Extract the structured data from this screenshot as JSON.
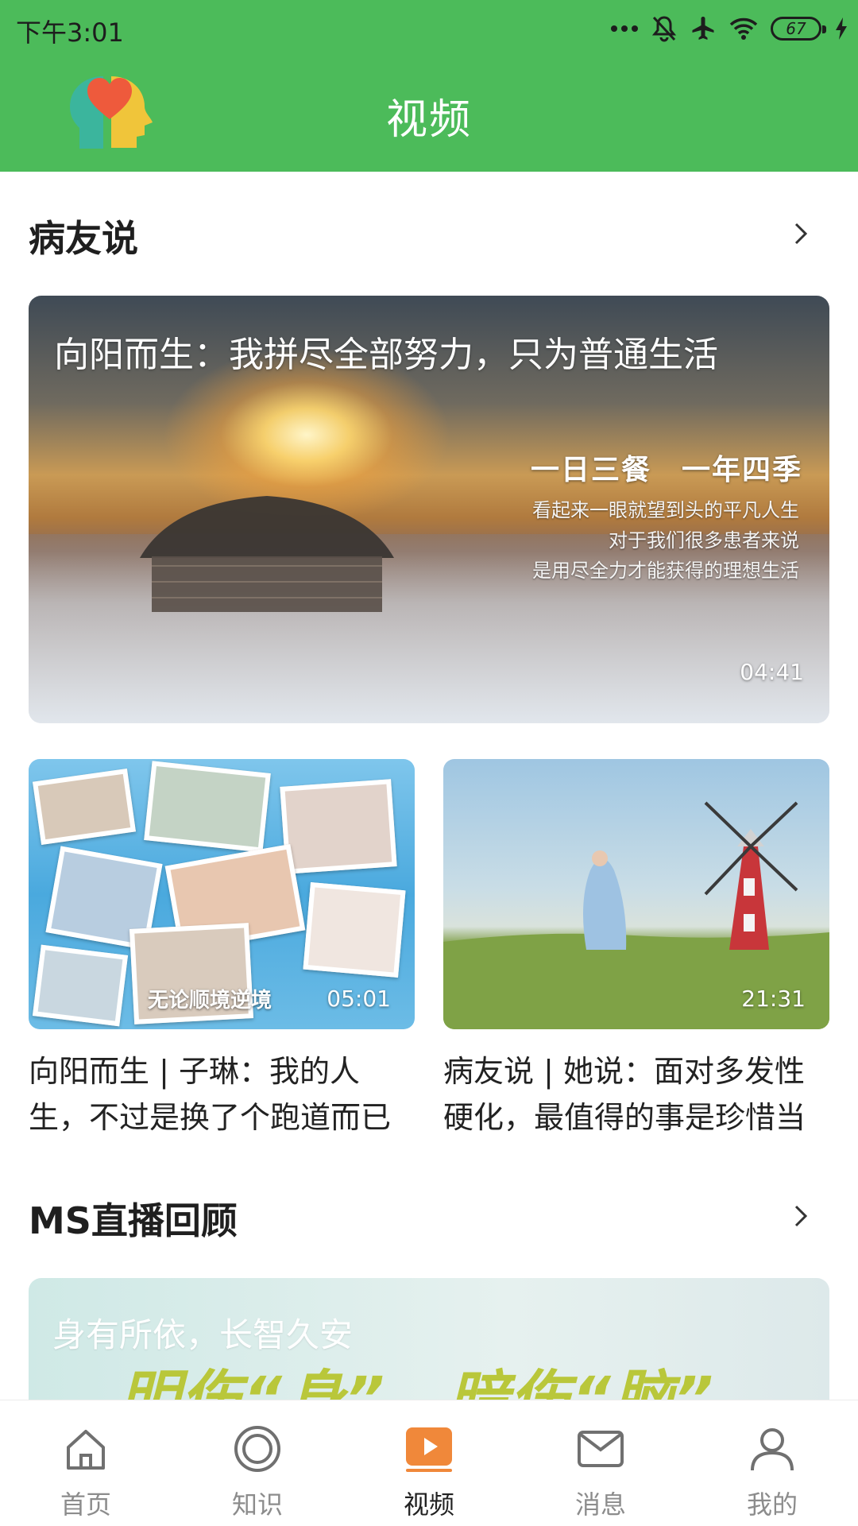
{
  "status_bar": {
    "time": "下午3:01",
    "battery": "67"
  },
  "header": {
    "title": "视频"
  },
  "sections": [
    {
      "title": "病友说"
    },
    {
      "title": "MS直播回顾"
    }
  ],
  "featured": {
    "title": "向阳而生：我拼尽全部努力，只为普通生活",
    "overlay_heading": "一日三餐　一年四季",
    "overlay_lines": [
      "看起来一眼就望到头的平凡人生",
      "对于我们很多患者来说",
      "是用尽全力才能获得的理想生活"
    ],
    "duration": "04:41"
  },
  "videos": [
    {
      "title": "向阳而生 | 子琳：我的人生，不过是换了个跑道而已",
      "caption": "无论顺境逆境",
      "duration": "05:01"
    },
    {
      "title": "病友说 | 她说：面对多发性硬化，最值得的事是珍惜当",
      "duration": "21:31"
    }
  ],
  "live_banner": {
    "subtitle": "身有所依，长智久安",
    "headline": "明伤“身”，暗伤“脑”，"
  },
  "tabs": [
    {
      "label": "首页",
      "icon": "home-icon"
    },
    {
      "label": "知识",
      "icon": "knowledge-icon"
    },
    {
      "label": "视频",
      "icon": "video-play-icon",
      "active": true
    },
    {
      "label": "消息",
      "icon": "mail-icon"
    },
    {
      "label": "我的",
      "icon": "person-icon"
    }
  ],
  "colors": {
    "brand_green": "#4cbb5a",
    "active_tab": "#f0883a",
    "inactive_tab": "#8c8c8c"
  }
}
